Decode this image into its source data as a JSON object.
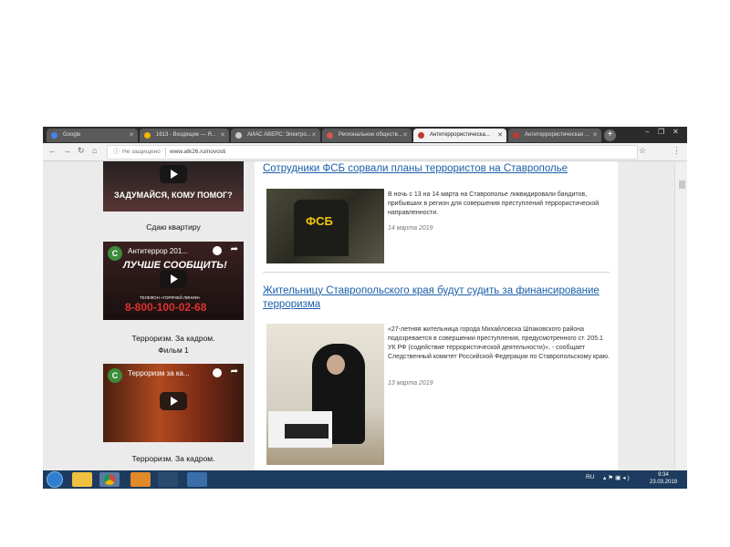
{
  "browser": {
    "tabs": [
      {
        "label": "Google",
        "active": false,
        "fav_color": "#4285f4"
      },
      {
        "label": "1613 - Входящие — Я...",
        "active": false,
        "fav_color": "#f4b400"
      },
      {
        "label": "АИАС АВЕРС: Электро...",
        "active": false,
        "fav_color": "#cccccc"
      },
      {
        "label": "Региональное обществ...",
        "active": false,
        "fav_color": "#d9534f"
      },
      {
        "label": "Антитеррористическа...",
        "active": true,
        "fav_color": "#c0392b"
      },
      {
        "label": "Антитеррористическая ...",
        "active": false,
        "fav_color": "#c0392b"
      }
    ],
    "newtab_icon": "+",
    "address": {
      "security_label": "Не защищено",
      "url": "www.atk26.ru/novosti"
    }
  },
  "sidebar": {
    "videos": [
      {
        "title": "",
        "overlay_text": "ЗАДУМАЙСЯ, КОМУ ПОМОГ?",
        "caption": "Сдаю квартиру"
      },
      {
        "channel_letter": "С",
        "title": "Антитеррор 201...",
        "overlay_text": "ЛУЧШЕ СООБЩИТЬ!",
        "phone_label": "ТЕЛЕФОН «ГОРЯЧЕЙ ЛИНИИ»",
        "phone": "8-800-100-02-68",
        "caption_line1": "Терроризм.  За кадром.",
        "caption_line2": "Фильм 1"
      },
      {
        "channel_letter": "С",
        "title": "Терроризм за ка...",
        "caption_line1": "Терроризм.  За кадром."
      }
    ]
  },
  "articles": [
    {
      "headline": "Сотрудники ФСБ сорвали планы террористов на Ставрополье",
      "image_label": "ФСБ",
      "excerpt": "В ночь с 13 на 14 марта на Ставрополье ликвидировали бандитов, прибывших в регион для совершения преступлений террористической направленности.",
      "date": "14 марта 2019"
    },
    {
      "headline_line1": "Жительницу Ставропольского края будут судить за финансирование",
      "headline_line2": "терроризма",
      "excerpt": "«27-летняя жительница города Михайловска Шпаковского района подозревается в  совершении преступления, предусмотренного ст. 205.1 УК РФ (содействие террористической деятельности)», - сообщает Следственный комитет Российской Федерации по Ставропольскому краю.",
      "date": "13 марта 2019"
    }
  ],
  "taskbar": {
    "lang": "RU",
    "time": "9:34",
    "date": "23.03.2019"
  },
  "colors": {
    "link": "#1c5fa8",
    "taskbar": "#1c3b5e",
    "tabstrip": "#2b2b2b"
  }
}
